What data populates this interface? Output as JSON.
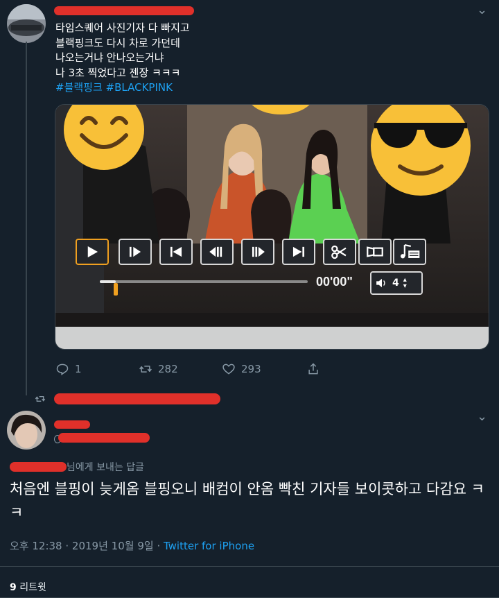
{
  "tweet": {
    "text_lines": [
      "타임스퀘어 사진기자 다 빠지고",
      "블랙핑크도 다시 차로 가던데",
      "나오는거냐 안나오는거냐",
      "나 3초 찍었다고 젠장 ㅋㅋㅋ"
    ],
    "hashtags": "#블랙핑크 #BLACKPINK",
    "video": {
      "time": "00'00\"",
      "volume_level": "4",
      "progress": 0.03
    },
    "actions": {
      "replies": "1",
      "retweets": "282",
      "likes": "293"
    }
  },
  "reply": {
    "replying_to_suffix": "님에게 보내는 답글",
    "text": "처음엔 블핑이 늦게옴 블핑오니 배컴이 안옴 빡친 기자들 보이콧하고 다감요 ㅋㅋ",
    "time": "오후 12:38",
    "date": "2019년 10월 9일",
    "source": "Twitter for iPhone",
    "retweet_count": "9",
    "retweet_label": "리트윗"
  },
  "colors": {
    "background": "#15202b",
    "link": "#1da1f2",
    "muted": "#8899a6",
    "redaction": "#e0302a"
  }
}
